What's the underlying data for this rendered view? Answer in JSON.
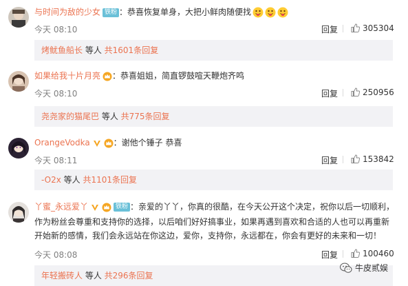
{
  "comments": [
    {
      "username": "与时间为敌的少女",
      "badge": "铁粉",
      "text": "：恭喜恢复单身，大把小鲜肉随便找",
      "emoji_icon": "tongue-face-emoji",
      "time": "今天 08:10",
      "reply_label": "回复",
      "likes": "305304",
      "sub": {
        "name": "烤鱿鱼船长",
        "deng": " 等人 ",
        "count": "共1601条回复"
      }
    },
    {
      "username": "如果给我十片月亮",
      "badge": "",
      "text": "：恭喜姐姐，简直锣鼓喧天鞭炮齐鸣",
      "time": "今天 08:10",
      "reply_label": "回复",
      "likes": "250956",
      "sub": {
        "name": "尧尧家的猫尾巴",
        "deng": " 等人 ",
        "count": "共775条回复"
      }
    },
    {
      "username": "OrangeVodka",
      "badge": "",
      "text": "：谢他个锤子 恭喜",
      "time": "今天 08:11",
      "reply_label": "回复",
      "likes": "153842",
      "sub": {
        "name": "-O2x",
        "deng": " 等人 ",
        "count": "共1101条回复"
      }
    },
    {
      "username": "丫蜜_永远爱丫",
      "badge": "铁粉",
      "text_lines": [
        "：亲爱的丫丫，你真的很酷，在今天公开这个决定，祝你以后一切顺利，",
        "作为粉丝会尊重和支持你的选择，以后咱们好好搞事业，如果再遇到喜欢和合适的人也可以再重新",
        "开始新的感情，我们会永远站在你这边，爱你，支持你，永远都在，你会有更好的未来和一切！"
      ],
      "time": "今天 08:08",
      "reply_label": "回复",
      "likes": "100460",
      "sub": {
        "name": "年轻搬砖人",
        "deng": " 等人 ",
        "count": "共296条回复"
      }
    }
  ],
  "watermark": {
    "text": "牛皮贰娱",
    "icon": "wechat-icon"
  },
  "colors": {
    "name": "#eb7350",
    "badge": "#6ac0d8",
    "sub_bg": "#f2f2f5"
  }
}
